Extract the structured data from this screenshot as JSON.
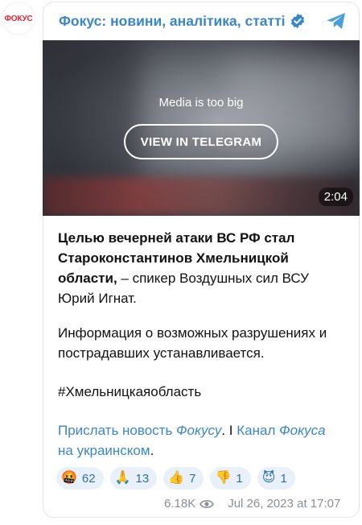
{
  "avatar": {
    "label": "ФОКУС"
  },
  "channel": {
    "title": "Фокус: новини, аналітика, статті"
  },
  "media": {
    "note": "Media is too big",
    "button": "VIEW IN TELEGRAM",
    "duration": "2:04"
  },
  "post": {
    "p1_bold": "Целью вечерней атаки ВС РФ стал Староконстантинов Хмельницкой области,",
    "p1_rest": " – спикер Воздушных сил ВСУ Юрий Игнат.",
    "p2": "Информация о возможных разрушениях и пострадавших устанавливается.",
    "p3": "#Хмельницкаяобласть",
    "link1_a": "Прислать новость ",
    "link1_b": "Фокусу",
    "sep1": ". I ",
    "link2_a": "Канал ",
    "link2_b": "Фокуса",
    "link2_c": " на украинском",
    "end": "."
  },
  "reactions": [
    {
      "emoji": "🤬",
      "count": "62"
    },
    {
      "emoji": "🙏",
      "count": "13"
    },
    {
      "emoji": "👍",
      "count": "7"
    },
    {
      "emoji": "👎",
      "count": "1"
    },
    {
      "emoji": "😈",
      "count": "1"
    }
  ],
  "meta": {
    "views": "6.18K",
    "date": "Jul 26, 2023 at 17:07"
  },
  "colors": {
    "accent": "#3a87c8",
    "brand": "#e0243a"
  }
}
